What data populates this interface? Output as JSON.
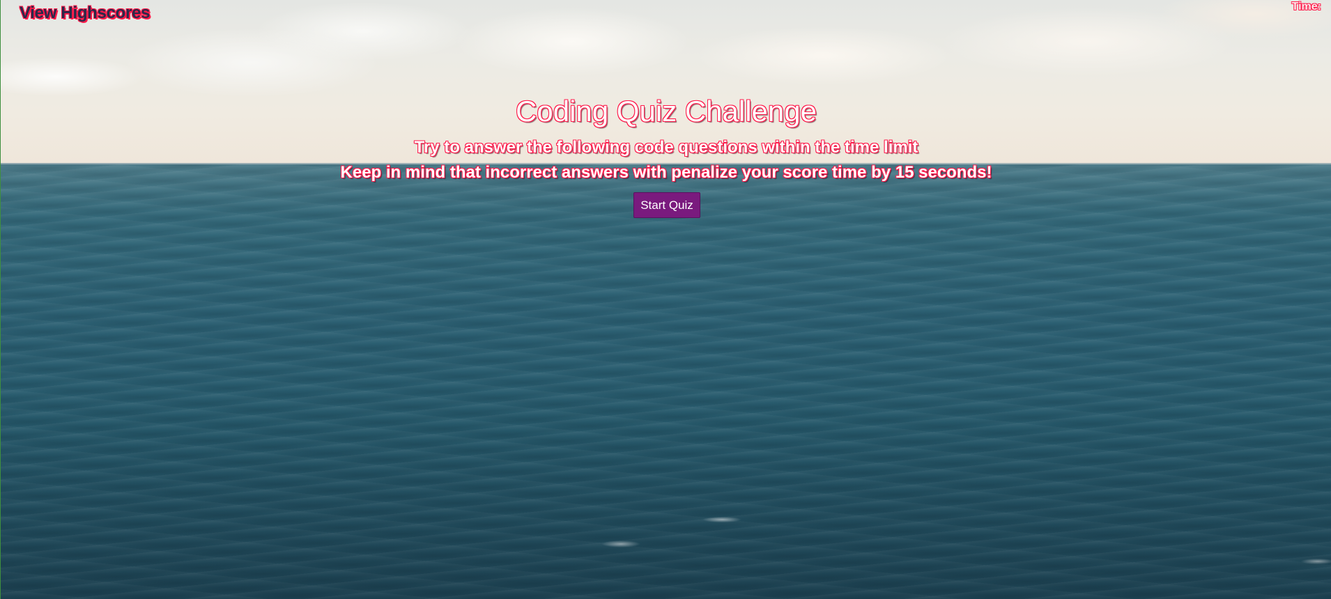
{
  "header": {
    "highscores_link": "View Highscores",
    "timer_label": "Time:"
  },
  "intro": {
    "title": "Coding Quiz Challenge",
    "line1": "Try to answer the following code questions within the time limit",
    "line2": "Keep in mind that incorrect answers with penalize your score time by 15 seconds!",
    "start_button": "Start Quiz"
  },
  "colors": {
    "text_outline": "#ff1a4a",
    "button_bg": "#7a1a7e",
    "button_text": "#ffffff"
  }
}
